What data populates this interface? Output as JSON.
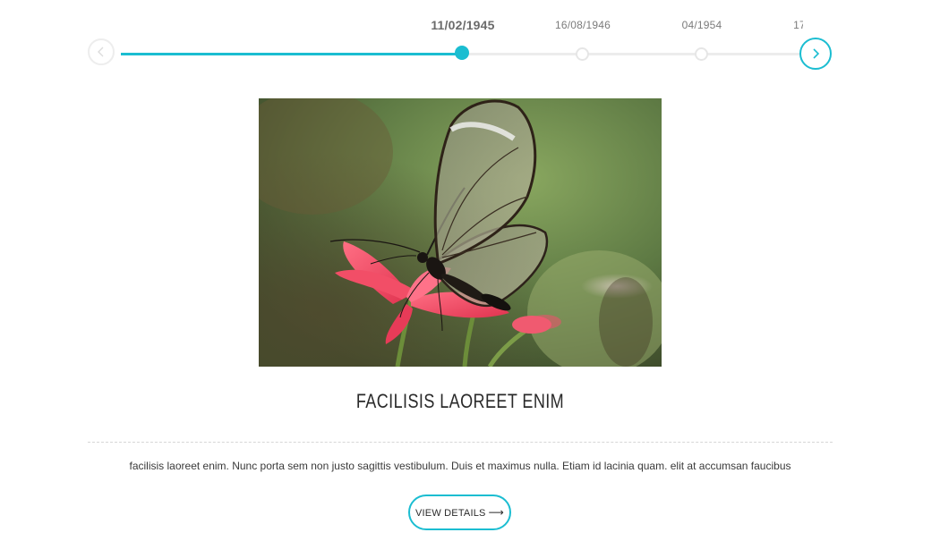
{
  "timeline": {
    "events": [
      {
        "date": "11/02/1945",
        "active": true
      },
      {
        "date": "16/08/1946",
        "active": false
      },
      {
        "date": "04/1954",
        "active": false
      },
      {
        "date": "17",
        "active": false
      }
    ],
    "prev_icon": "chevron-left-icon",
    "next_icon": "chevron-right-icon",
    "accent_color": "#1bbdd1",
    "progress_fraction": 0.5
  },
  "content": {
    "image_alt_icon": "butterfly-photo",
    "title": "FACILISIS LAOREET ENIM",
    "description": "facilisis laoreet enim. Nunc porta sem non justo sagittis vestibulum. Duis et maximus nulla. Etiam id lacinia quam. elit at accumsan faucibus",
    "button_label": "VIEW DETAILS",
    "button_arrow": "⟶"
  }
}
